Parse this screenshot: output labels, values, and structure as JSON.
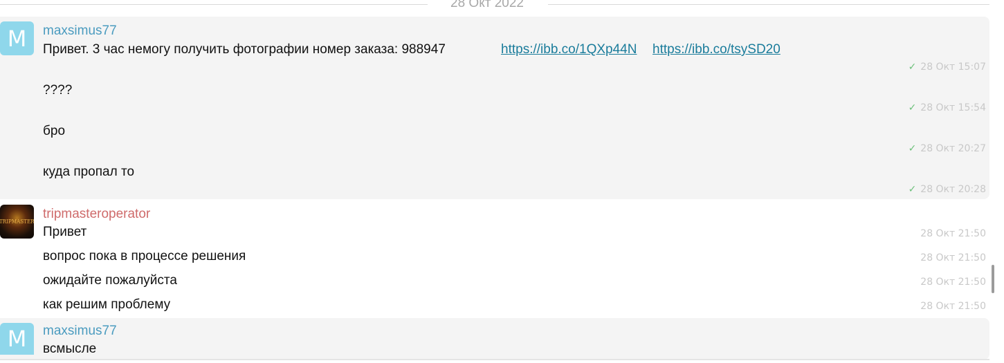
{
  "date_separator": "28 Окт 2022",
  "groups": [
    {
      "sender": "maxsimus77",
      "avatar_letter": "M",
      "messages": [
        {
          "text": "Привет. 3 час немогу получить фотографии номер заказа: 988947",
          "link1": "https://ibb.co/1QXp44N",
          "link2": "https://ibb.co/tsySD20",
          "time": "28 Окт 15:07",
          "read": true
        },
        {
          "text": "????",
          "time": "28 Окт 15:54",
          "read": true
        },
        {
          "text": "бро",
          "time": "28 Окт 20:27",
          "read": true
        },
        {
          "text": "куда пропал то",
          "time": "28 Окт 20:28",
          "read": true
        }
      ]
    },
    {
      "sender": "tripmasteroperator",
      "avatar_text": "TRIPMASTER",
      "messages": [
        {
          "text": "Привет",
          "time": "28 Окт 21:50"
        },
        {
          "text": "вопрос пока в процессе решения",
          "time": "28 Окт 21:50"
        },
        {
          "text": "ожидайте пожалуйста",
          "time": "28 Окт 21:50"
        },
        {
          "text": "как решим проблему",
          "time": "28 Окт 21:50"
        }
      ]
    },
    {
      "sender": "maxsimus77",
      "avatar_letter": "M",
      "messages": [
        {
          "text": "всмысле"
        }
      ]
    }
  ],
  "icons": {
    "read_check": "✓"
  }
}
